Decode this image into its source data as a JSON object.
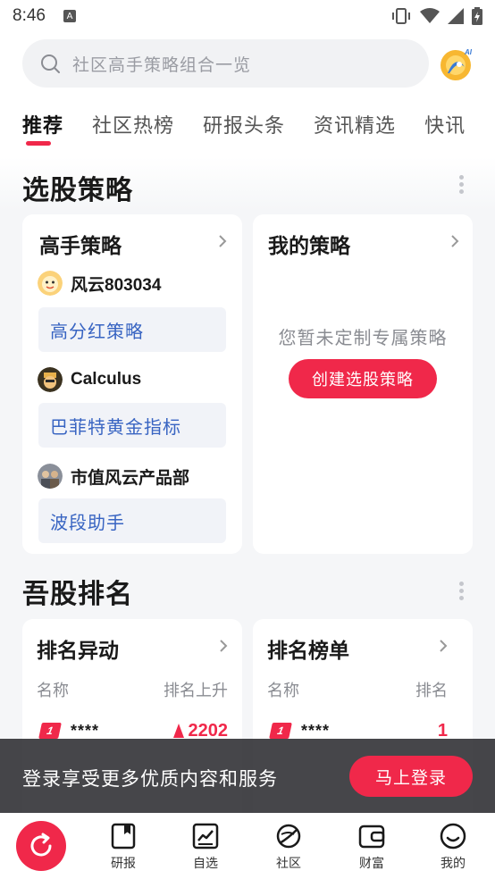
{
  "status_bar": {
    "time": "8:46",
    "a_icon": "A"
  },
  "search": {
    "placeholder": "社区高手策略组合一览",
    "icon": "search-icon"
  },
  "tabs": [
    {
      "label": "推荐",
      "active": true
    },
    {
      "label": "社区热榜",
      "active": false
    },
    {
      "label": "研报头条",
      "active": false
    },
    {
      "label": "资讯精选",
      "active": false
    },
    {
      "label": "快讯",
      "active": false
    }
  ],
  "stock_strategy": {
    "title": "选股策略",
    "expert_card": {
      "title": "高手策略",
      "experts": [
        {
          "name": "风云803034",
          "strategy": "高分红策略"
        },
        {
          "name": "Calculus",
          "strategy": "巴菲特黄金指标"
        },
        {
          "name": "市值风云产品部",
          "strategy": "波段助手"
        }
      ]
    },
    "my_card": {
      "title": "我的策略",
      "empty_text": "您暂未定制专属策略",
      "create_label": "创建选股策略"
    }
  },
  "ranking": {
    "title": "吾股排名",
    "change_card": {
      "title": "排名异动",
      "col_name": "名称",
      "col_value": "排名上升",
      "rows": [
        {
          "badge": "1",
          "name": "****",
          "value": "2202"
        }
      ]
    },
    "list_card": {
      "title": "排名榜单",
      "col_name": "名称",
      "col_value": "排名",
      "rows": [
        {
          "badge": "1",
          "name": "****",
          "value": "1"
        }
      ]
    }
  },
  "login_prompt": {
    "text": "登录享受更多优质内容和服务",
    "button": "马上登录"
  },
  "bottom_nav": [
    {
      "label": "研报",
      "icon": "bookmark-icon"
    },
    {
      "label": "自选",
      "icon": "chart-icon"
    },
    {
      "label": "社区",
      "icon": "planet-icon"
    },
    {
      "label": "财富",
      "icon": "wallet-icon"
    },
    {
      "label": "我的",
      "icon": "smile-icon"
    }
  ],
  "colors": {
    "accent": "#f0284a",
    "link_blue": "#3864c2",
    "pill_bg": "#f1f3f8"
  }
}
